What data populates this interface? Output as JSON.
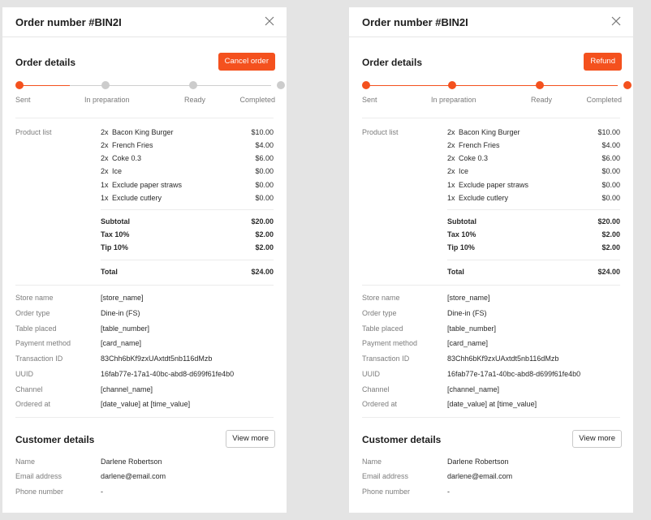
{
  "left": {
    "title": "Order number #BIN2I",
    "order_details_title": "Order details",
    "action_label": "Cancel order",
    "steps_reached": 1,
    "steps": [
      "Sent",
      "In preparation",
      "Ready",
      "Completed"
    ],
    "product_list_label": "Product list",
    "products": [
      {
        "qty": "2x",
        "name": "Bacon King Burger",
        "price": "$10.00"
      },
      {
        "qty": "2x",
        "name": "French Fries",
        "price": "$4.00"
      },
      {
        "qty": "2x",
        "name": "Coke 0.3",
        "price": "$6.00"
      },
      {
        "qty": "2x",
        "name": "Ice",
        "price": "$0.00"
      },
      {
        "qty": "1x",
        "name": "Exclude paper straws",
        "price": "$0.00"
      },
      {
        "qty": "1x",
        "name": "Exclude cutlery",
        "price": "$0.00"
      }
    ],
    "subtotals": [
      {
        "label": "Subtotal",
        "value": "$20.00"
      },
      {
        "label": "Tax 10%",
        "value": "$2.00"
      },
      {
        "label": "Tip 10%",
        "value": "$2.00"
      }
    ],
    "total": {
      "label": "Total",
      "value": "$24.00"
    },
    "info": [
      {
        "label": "Store name",
        "value": "[store_name]"
      },
      {
        "label": "Order type",
        "value": "Dine-in (FS)"
      },
      {
        "label": "Table placed",
        "value": "[table_number]"
      },
      {
        "label": "Payment method",
        "value": "[card_name]"
      },
      {
        "label": "Transaction ID",
        "value": "83Chh6bKf9zxUAxtdt5nb116dMzb"
      },
      {
        "label": "UUID",
        "value": "16fab77e-17a1-40bc-abd8-d699f61fe4b0"
      },
      {
        "label": "Channel",
        "value": "[channel_name]"
      },
      {
        "label": "Ordered at",
        "value": "[date_value] at [time_value]"
      }
    ],
    "customer_title": "Customer details",
    "view_more_label": "View more",
    "customer": [
      {
        "label": "Name",
        "value": "Darlene Robertson"
      },
      {
        "label": "Email address",
        "value": "darlene@email.com"
      },
      {
        "label": "Phone number",
        "value": "-"
      }
    ]
  },
  "right": {
    "title": "Order number #BIN2I",
    "order_details_title": "Order details",
    "action_label": "Refund",
    "steps_reached": 4,
    "steps": [
      "Sent",
      "In preparation",
      "Ready",
      "Completed"
    ],
    "product_list_label": "Product list",
    "products": [
      {
        "qty": "2x",
        "name": "Bacon King Burger",
        "price": "$10.00"
      },
      {
        "qty": "2x",
        "name": "French Fries",
        "price": "$4.00"
      },
      {
        "qty": "2x",
        "name": "Coke 0.3",
        "price": "$6.00"
      },
      {
        "qty": "2x",
        "name": "Ice",
        "price": "$0.00"
      },
      {
        "qty": "1x",
        "name": "Exclude paper straws",
        "price": "$0.00"
      },
      {
        "qty": "1x",
        "name": "Exclude cutlery",
        "price": "$0.00"
      }
    ],
    "subtotals": [
      {
        "label": "Subtotal",
        "value": "$20.00"
      },
      {
        "label": "Tax 10%",
        "value": "$2.00"
      },
      {
        "label": "Tip 10%",
        "value": "$2.00"
      }
    ],
    "total": {
      "label": "Total",
      "value": "$24.00"
    },
    "info": [
      {
        "label": "Store name",
        "value": "[store_name]"
      },
      {
        "label": "Order type",
        "value": "Dine-in (FS)"
      },
      {
        "label": "Table placed",
        "value": "[table_number]"
      },
      {
        "label": "Payment method",
        "value": "[card_name]"
      },
      {
        "label": "Transaction ID",
        "value": "83Chh6bKf9zxUAxtdt5nb116dMzb"
      },
      {
        "label": "UUID",
        "value": "16fab77e-17a1-40bc-abd8-d699f61fe4b0"
      },
      {
        "label": "Channel",
        "value": "[channel_name]"
      },
      {
        "label": "Ordered at",
        "value": "[date_value] at [time_value]"
      }
    ],
    "customer_title": "Customer details",
    "view_more_label": "View more",
    "customer": [
      {
        "label": "Name",
        "value": "Darlene Robertson"
      },
      {
        "label": "Email address",
        "value": "darlene@email.com"
      },
      {
        "label": "Phone number",
        "value": "-"
      }
    ]
  },
  "colors": {
    "accent": "#f4511e",
    "step_inactive": "#cccccc",
    "background": "#e4e4e4"
  }
}
